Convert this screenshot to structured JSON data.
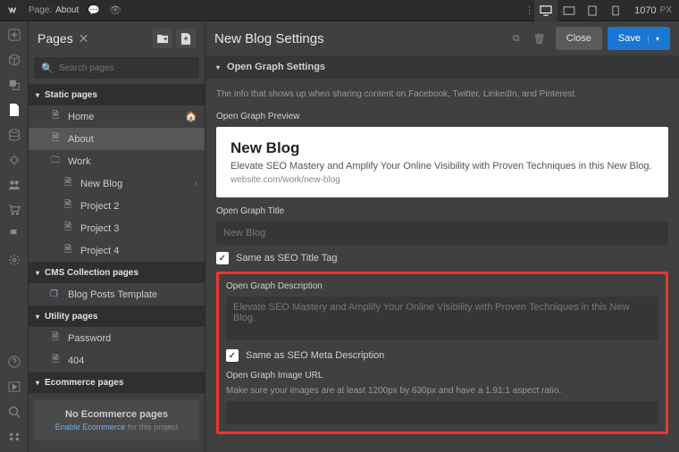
{
  "topbar": {
    "pageLabel": "Page:",
    "pageName": "About",
    "width": "1070",
    "pxLabel": "PX"
  },
  "pages": {
    "title": "Pages",
    "searchPlaceholder": "Search pages",
    "static": {
      "label": "Static pages",
      "items": [
        {
          "label": "Home",
          "icon": "page",
          "home": true
        },
        {
          "label": "About",
          "icon": "page",
          "selected": true
        },
        {
          "label": "Work",
          "icon": "folder"
        },
        {
          "label": "New Blog",
          "icon": "page",
          "indent": 2,
          "arrow": true
        },
        {
          "label": "Project 2",
          "icon": "page",
          "indent": 2
        },
        {
          "label": "Project 3",
          "icon": "page",
          "indent": 2
        },
        {
          "label": "Project 4",
          "icon": "page",
          "indent": 2
        }
      ]
    },
    "cms": {
      "label": "CMS Collection pages",
      "items": [
        {
          "label": "Blog Posts Template",
          "icon": "stack"
        }
      ]
    },
    "utility": {
      "label": "Utility pages",
      "items": [
        {
          "label": "Password",
          "icon": "page"
        },
        {
          "label": "404",
          "icon": "page"
        }
      ]
    },
    "ecommerce": {
      "label": "Ecommerce pages",
      "empty": {
        "title": "No Ecommerce pages",
        "link": "Enable Ecommerce",
        "rest": " for this project"
      }
    }
  },
  "settings": {
    "title": "New Blog Settings",
    "close": "Close",
    "save": "Save",
    "section": "Open Graph Settings",
    "info": "The info that shows up when sharing content on Facebook, Twitter, LinkedIn, and Pinterest.",
    "previewLabel": "Open Graph Preview",
    "preview": {
      "title": "New Blog",
      "desc": "Elevate SEO Mastery and Amplify Your Online Visibility with Proven Techniques in this New Blog.",
      "url": "website.com/work/new-blog"
    },
    "ogTitle": {
      "label": "Open Graph Title",
      "value": "New Blog",
      "check": "Same as SEO Title Tag"
    },
    "ogDesc": {
      "label": "Open Graph Description",
      "value": "Elevate SEO Mastery and Amplify Your Online Visibility with Proven Techniques in this New Blog.",
      "check": "Same as SEO Meta Description"
    },
    "ogImage": {
      "label": "Open Graph Image URL",
      "sub": "Make sure your images are at least 1200px by 630px and have a 1.91:1 aspect ratio."
    }
  }
}
